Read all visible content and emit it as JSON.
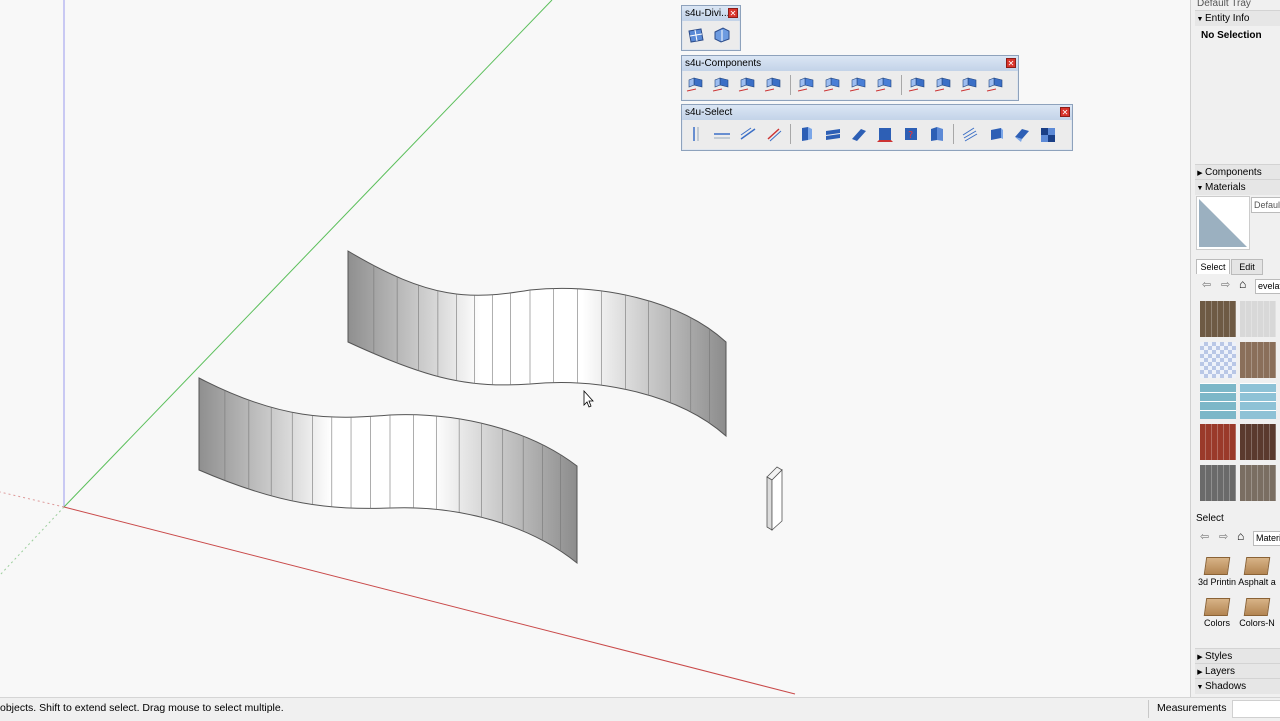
{
  "toolbars": {
    "divide": {
      "title": "s4u-Divi..."
    },
    "components": {
      "title": "s4u-Components"
    },
    "select": {
      "title": "s4u-Select"
    }
  },
  "tray": {
    "title": "Default Tray",
    "entity_info": {
      "header": "Entity Info",
      "value": "No Selection"
    },
    "components": {
      "header": "Components"
    },
    "materials": {
      "header": "Materials",
      "name_value": "Default",
      "tabs": [
        "Select",
        "Edit"
      ],
      "search_value": "evelat",
      "select_label": "Select",
      "collection_value": "Materi",
      "folders": [
        "3d Printin",
        "Asphalt a",
        "Colors",
        "Colors-N"
      ]
    },
    "styles": {
      "header": "Styles"
    },
    "layers": {
      "header": "Layers"
    },
    "shadows": {
      "header": "Shadows"
    }
  },
  "status": {
    "message": "objects. Shift to extend select. Drag mouse to select multiple.",
    "measurements_label": "Measurements"
  },
  "colors": {
    "green_axis": "#5bbf5b",
    "red_axis": "#c94a4a",
    "blue_axis": "#7a7ae0",
    "close_button": "#d9342c"
  }
}
